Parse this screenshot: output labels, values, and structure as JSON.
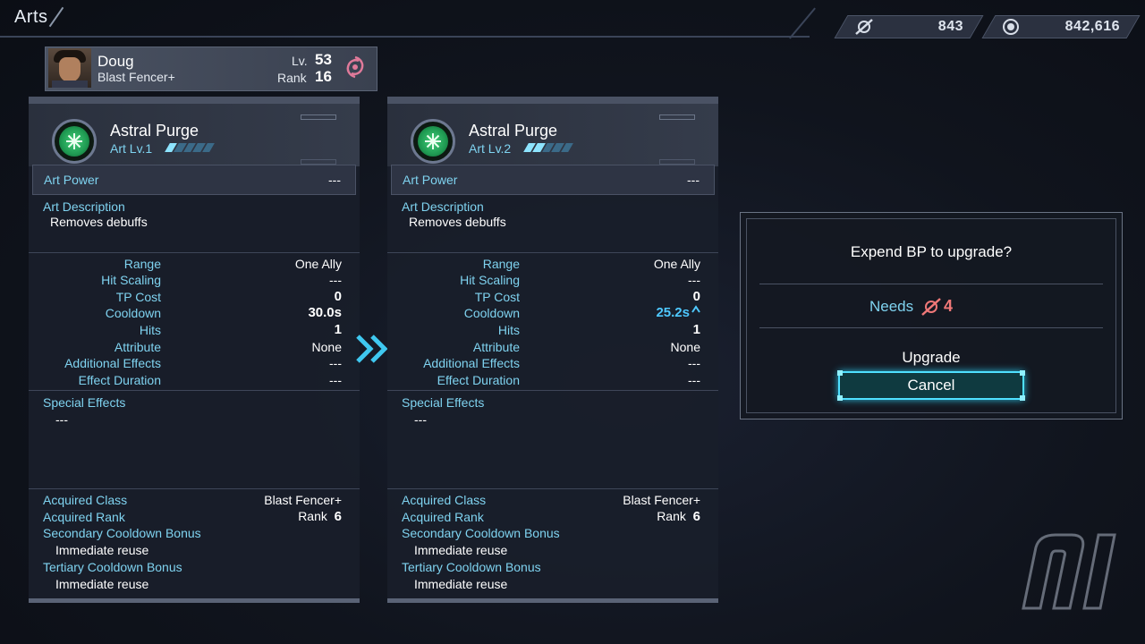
{
  "screen": {
    "title": "Arts"
  },
  "currency": {
    "bp_value": "843",
    "money_value": "842,616"
  },
  "character": {
    "name": "Doug",
    "class": "Blast Fencer+",
    "lv_label": "Lv.",
    "lv": "53",
    "rank_label": "Rank",
    "rank": "16"
  },
  "panels": [
    {
      "art_name": "Astral Purge",
      "art_level": "Art Lv.1",
      "level_pips": 1,
      "art_power_label": "Art Power",
      "art_power": "---",
      "desc_label": "Art Description",
      "desc": "Removes debuffs",
      "stats": [
        {
          "label": "Range",
          "value": "One Ally"
        },
        {
          "label": "Hit Scaling",
          "value": "---"
        },
        {
          "label": "TP Cost",
          "value": "0"
        },
        {
          "label": "Cooldown",
          "value": "30.0s"
        },
        {
          "label": "Hits",
          "value": "1"
        },
        {
          "label": "Attribute",
          "value": "None"
        },
        {
          "label": "Additional Effects",
          "value": "---"
        },
        {
          "label": "Effect Duration",
          "value": "---"
        }
      ],
      "special_label": "Special Effects",
      "special": "---",
      "acquired_class_label": "Acquired Class",
      "acquired_class": "Blast Fencer+",
      "acquired_rank_label": "Acquired Rank",
      "acquired_rank_prefix": "Rank",
      "acquired_rank": "6",
      "secondary_label": "Secondary Cooldown Bonus",
      "secondary": "Immediate reuse",
      "tertiary_label": "Tertiary Cooldown Bonus",
      "tertiary": "Immediate reuse"
    },
    {
      "art_name": "Astral Purge",
      "art_level": "Art Lv.2",
      "level_pips": 2,
      "art_power_label": "Art Power",
      "art_power": "---",
      "desc_label": "Art Description",
      "desc": "Removes debuffs",
      "stats": [
        {
          "label": "Range",
          "value": "One Ally"
        },
        {
          "label": "Hit Scaling",
          "value": "---"
        },
        {
          "label": "TP Cost",
          "value": "0"
        },
        {
          "label": "Cooldown",
          "value": "25.2s"
        },
        {
          "label": "Hits",
          "value": "1"
        },
        {
          "label": "Attribute",
          "value": "None"
        },
        {
          "label": "Additional Effects",
          "value": "---"
        },
        {
          "label": "Effect Duration",
          "value": "---"
        }
      ],
      "special_label": "Special Effects",
      "special": "---",
      "acquired_class_label": "Acquired Class",
      "acquired_class": "Blast Fencer+",
      "acquired_rank_label": "Acquired Rank",
      "acquired_rank_prefix": "Rank",
      "acquired_rank": "6",
      "secondary_label": "Secondary Cooldown Bonus",
      "secondary": "Immediate reuse",
      "tertiary_label": "Tertiary Cooldown Bonus",
      "tertiary": "Immediate reuse"
    }
  ],
  "dialog": {
    "title": "Expend BP to upgrade?",
    "needs_label": "Needs",
    "needs_value": "4",
    "options": [
      "Upgrade",
      "Cancel"
    ],
    "selected": "Cancel"
  },
  "colors": {
    "accent_cyan": "#7fd3f0",
    "improved_value": "#4ec8ff",
    "cost_red": "#f07878",
    "art_green": "#43d07a"
  },
  "icons": {
    "bp": "bp-icon",
    "money": "coin-icon",
    "class": "class-emblem-icon",
    "art": "art-icon",
    "arrow": "double-chevron-right-icon"
  },
  "watermark": "nl"
}
